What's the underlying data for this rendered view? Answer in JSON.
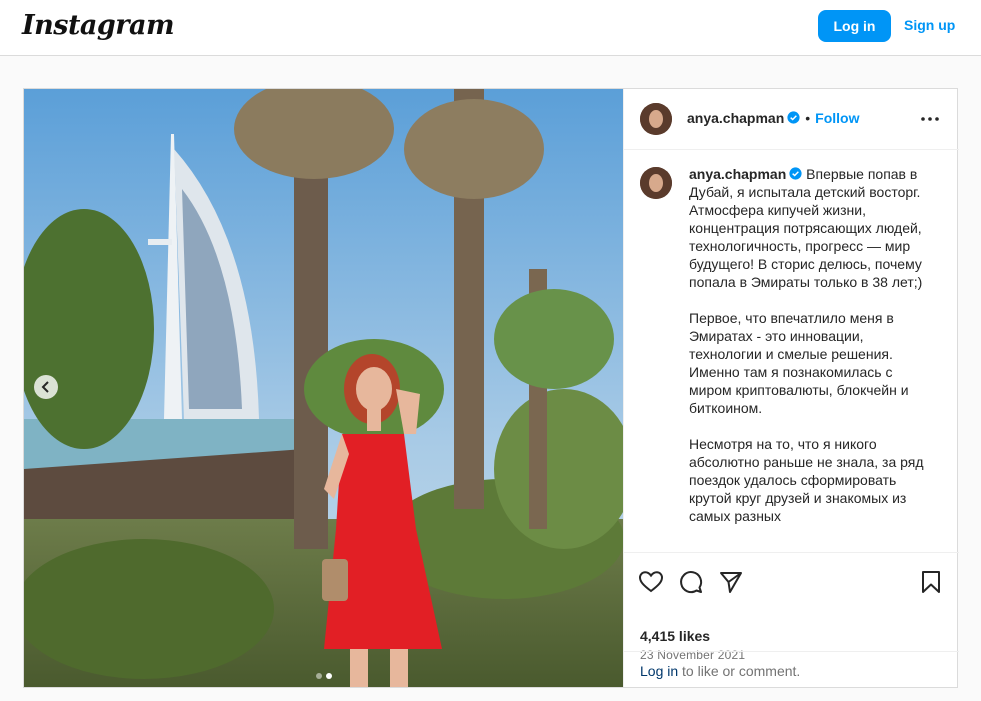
{
  "header": {
    "logo": "Instagram",
    "login_label": "Log in",
    "signup_label": "Sign up"
  },
  "post": {
    "username": "anya.chapman",
    "follow_label": "Follow",
    "separator": "•",
    "caption_paragraphs": [
      "Впервые попав в Дубай, я испытала детский восторг. Атмосфера кипучей жизни, концентрация потрясающих людей, технологичность, прогресс — мир будущего! В сторис делюсь, почему попала в Эмираты только в 38 лет;)",
      "Первое, что впечатлило меня в Эмиратах - это инновации, технологии и смелые решения. Именно там я познакомилась с миром криптовалюты, блокчейн и биткоином.",
      "Несмотря на то, что я никого абсолютно раньше не знала, за ряд поездок удалось сформировать крутой круг друзей и знакомых из самых разных"
    ],
    "likes": "4,415 likes",
    "date": "23 November 2021",
    "login_prompt_link": "Log in",
    "login_prompt_rest": " to like or comment.",
    "carousel": {
      "current": 2,
      "total": 2
    }
  },
  "icons": {
    "verified": "verified-badge-icon",
    "more": "more-options-icon",
    "like": "heart-icon",
    "comment": "comment-icon",
    "share": "share-icon",
    "save": "bookmark-icon",
    "prev": "chevron-left-icon"
  },
  "colors": {
    "brand_blue": "#0095f6",
    "link_dark": "#00376b",
    "muted": "#737373",
    "border": "#dbdbdb"
  }
}
